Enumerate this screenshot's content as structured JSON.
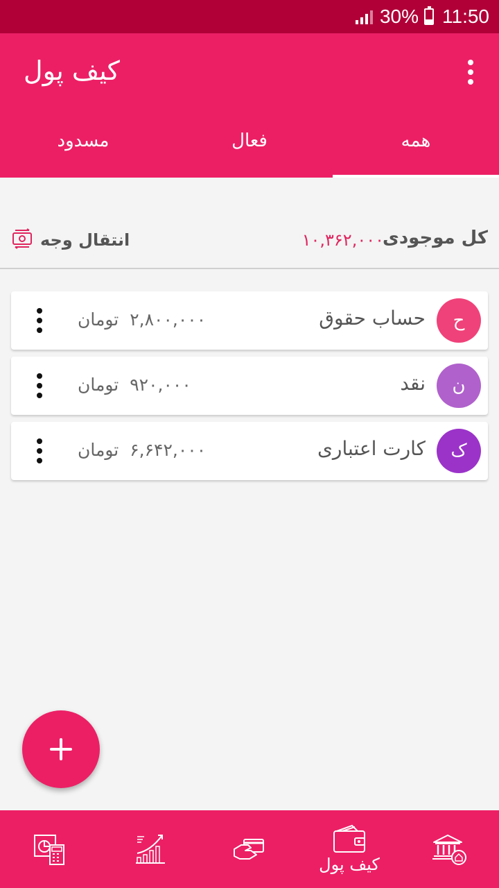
{
  "statusbar": {
    "battery": "30%",
    "time": "11:50"
  },
  "appbar": {
    "title": "کیف پول"
  },
  "tabs": [
    {
      "label": "همه",
      "active": true
    },
    {
      "label": "فعال",
      "active": false
    },
    {
      "label": "مسدود",
      "active": false
    }
  ],
  "summary": {
    "total_label": "کل موجودی",
    "total_value": "۱۰,۳۶۲,۰۰۰",
    "transfer_label": "انتقال وجه"
  },
  "accounts": [
    {
      "initial": "ح",
      "name": "حساب حقوق",
      "amount": "۲,۸۰۰,۰۰۰",
      "currency": "تومان",
      "color": "#f0427a"
    },
    {
      "initial": "ن",
      "name": "نقد",
      "amount": "۹۲۰,۰۰۰",
      "currency": "تومان",
      "color": "#b061cc"
    },
    {
      "initial": "ک",
      "name": "کارت اعتباری",
      "amount": "۶,۶۴۲,۰۰۰",
      "currency": "تومان",
      "color": "#9b33c9"
    }
  ],
  "bottomnav": {
    "wallet_label": "کیف پول",
    "icons": [
      "calculator-report-icon",
      "growth-chart-icon",
      "card-payment-icon",
      "wallet-icon",
      "bank-icon"
    ]
  },
  "colors": {
    "primary": "#ec1f65",
    "status_bar": "#b10038",
    "accent_text": "#e0245e"
  }
}
